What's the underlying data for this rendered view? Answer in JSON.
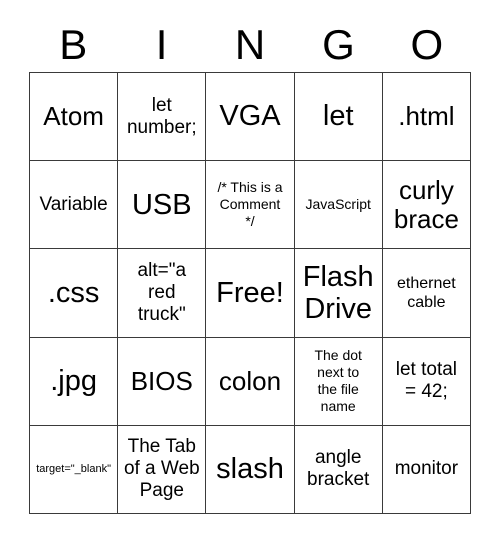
{
  "card": {
    "type": "bingo-card",
    "header_letters": [
      "B",
      "I",
      "N",
      "G",
      "O"
    ],
    "columns": 5,
    "rows": 5,
    "border_color": "#3a3a3a",
    "background_color": "#ffffff",
    "text_color": "#000000",
    "cells": [
      {
        "text": "Atom",
        "size": "xl"
      },
      {
        "text": "let\nnumber;",
        "size": "md"
      },
      {
        "text": "VGA",
        "size": "xxl"
      },
      {
        "text": "let",
        "size": "xxl"
      },
      {
        "text": ".html",
        "size": "xl"
      },
      {
        "text": "Variable",
        "size": "md"
      },
      {
        "text": "USB",
        "size": "xxl"
      },
      {
        "text": "/* This is a\nComment\n*/",
        "size": "xs"
      },
      {
        "text": "JavaScript",
        "size": "xs"
      },
      {
        "text": "curly\nbrace",
        "size": "xl"
      },
      {
        "text": ".css",
        "size": "xxl"
      },
      {
        "text": "alt=\"a\nred\ntruck\"",
        "size": "md"
      },
      {
        "text": "Free!",
        "size": "xxl"
      },
      {
        "text": "Flash\nDrive",
        "size": "xxl"
      },
      {
        "text": "ethernet\ncable",
        "size": "sm"
      },
      {
        "text": ".jpg",
        "size": "xxl"
      },
      {
        "text": "BIOS",
        "size": "xl"
      },
      {
        "text": "colon",
        "size": "xl"
      },
      {
        "text": "The dot\nnext to\nthe file\nname",
        "size": "xs"
      },
      {
        "text": "let total\n= 42;",
        "size": "md"
      },
      {
        "text": "target=\"_blank\"",
        "size": "xxs"
      },
      {
        "text": "The Tab\nof a Web\nPage",
        "size": "md"
      },
      {
        "text": "slash",
        "size": "xxl"
      },
      {
        "text": "angle\nbracket",
        "size": "md"
      },
      {
        "text": "monitor",
        "size": "md"
      }
    ]
  }
}
